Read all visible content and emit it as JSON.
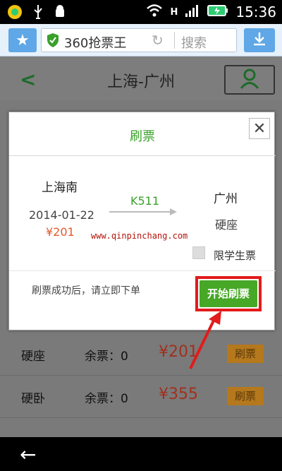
{
  "status_bar": {
    "time": "15:36",
    "network": "H"
  },
  "browser": {
    "site_title": "360抢票王",
    "search_placeholder": "搜索"
  },
  "page": {
    "title": "上海-广州"
  },
  "dialog": {
    "title": "刷票",
    "from_station": "上海南",
    "to_station": "广州",
    "train_no": "K511",
    "date": "2014-01-22",
    "price": "¥201",
    "seat_type": "硬座",
    "student_ticket_label": "限学生票",
    "watermark": "www.qinpinchang.com",
    "hint": "刷票成功后，请立即下单",
    "start_button": "开始刷票"
  },
  "ticket_list": [
    {
      "seat": "硬座",
      "remaining": "余票：0",
      "price": "¥201",
      "action": "刷票"
    },
    {
      "seat": "硬卧",
      "remaining": "余票：0",
      "price": "¥355",
      "action": "刷票"
    }
  ],
  "colors": {
    "accent_green": "#46a826",
    "title_green": "#3aa02a",
    "price_orange": "#e5582b",
    "highlight_red": "#e21b1b",
    "browser_blue": "#5fa7e6"
  }
}
